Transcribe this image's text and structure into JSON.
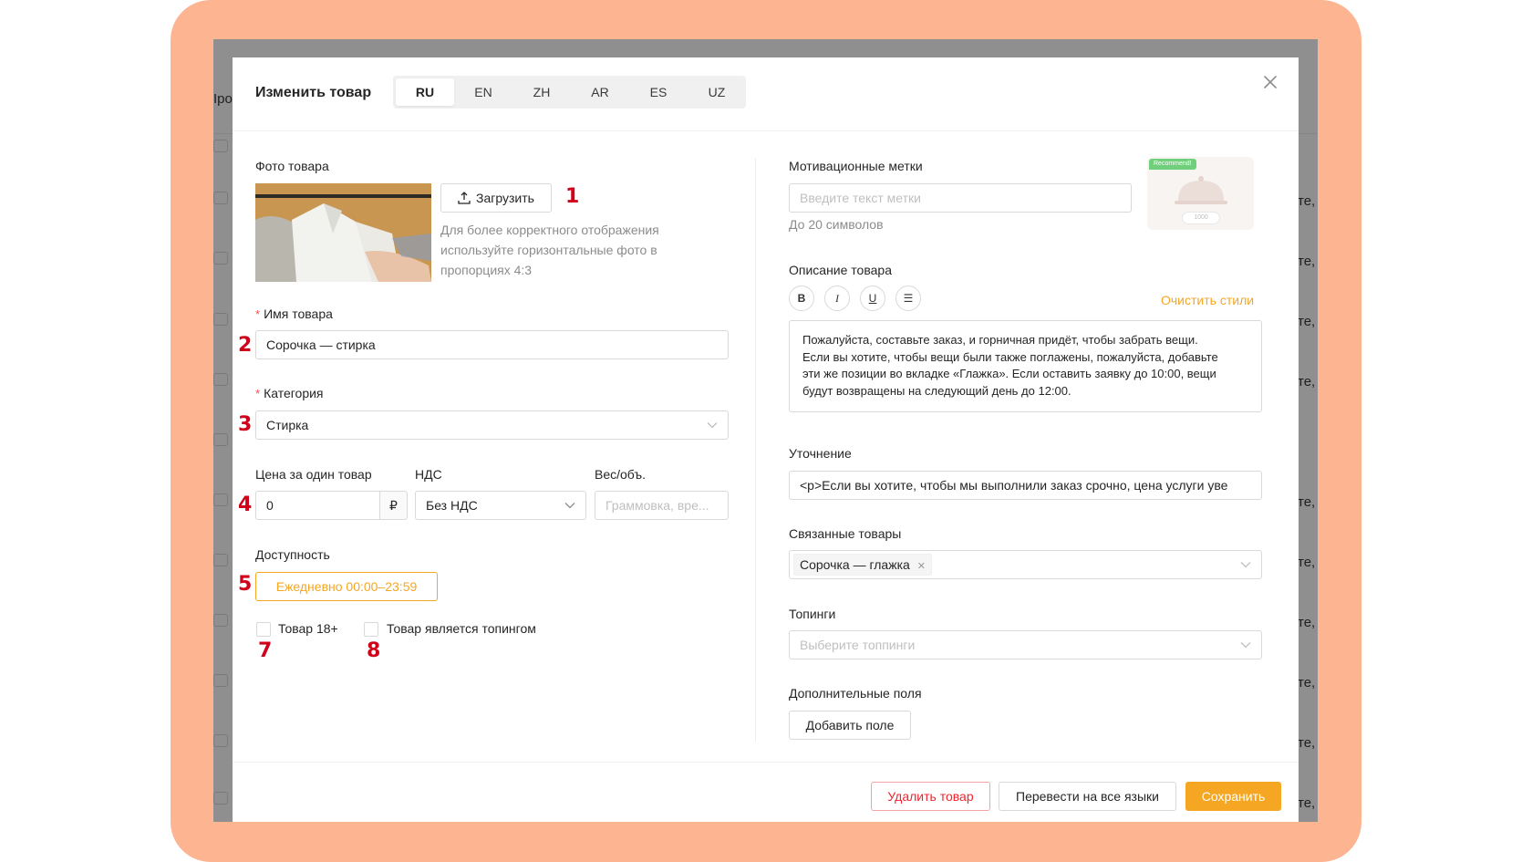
{
  "background": {
    "left_fragment": "Іро,",
    "right_fragments": [
      "те,",
      "те,",
      "те,",
      "те,",
      "те,",
      "те,",
      "те,",
      "те,",
      "те,",
      "те,"
    ]
  },
  "modal": {
    "title": "Изменить товар",
    "tabs": [
      {
        "label": "RU",
        "active": true
      },
      {
        "label": "EN",
        "active": false
      },
      {
        "label": "ZH",
        "active": false
      },
      {
        "label": "AR",
        "active": false
      },
      {
        "label": "ES",
        "active": false
      },
      {
        "label": "UZ",
        "active": false
      }
    ]
  },
  "left": {
    "photo_label": "Фото товара",
    "upload_button": "Загрузить",
    "photo_hint": [
      "Для более корректного отображения",
      "используйте горизонтальные фото в",
      "пропорциях 4:3"
    ],
    "name_label": "Имя товара",
    "name_value": "Сорочка — стирка",
    "category_label": "Категория",
    "category_value": "Стирка",
    "price_label": "Цена за один товар",
    "price_value": "0",
    "currency": "₽",
    "vat_label": "НДС",
    "vat_value": "Без НДС",
    "weight_label": "Вес/объ.",
    "weight_placeholder": "Граммовка, вре...",
    "availability_label": "Доступность",
    "availability_tag": "Ежедневно 00:00–23:59",
    "checkbox_adult": "Товар 18+",
    "checkbox_topping": "Товар является топингом"
  },
  "right": {
    "motivation_label": "Мотивационные метки",
    "motivation_placeholder": "Введите текст метки",
    "motivation_hint": "До 20 символов",
    "preview_badge": "Recommend!",
    "preview_price": "1000",
    "description_label": "Описание товара",
    "clear_styles": "Очистить стили",
    "format_buttons": [
      "B",
      "I",
      "U",
      "☰"
    ],
    "description_text": [
      "Пожалуйста, составьте заказ, и горничная придёт, чтобы забрать вещи.",
      "Если вы хотите, чтобы вещи были также поглажены, пожалуйста, добавьте",
      "эти же позиции во вкладке «Глажка». Если оставить заявку до 10:00, вещи",
      "будут возвращены на следующий день до 12:00."
    ],
    "clarification_label": "Уточнение",
    "clarification_value": "<p>Если вы хотите, чтобы мы выполнили заказ срочно, цена услуги уве",
    "related_label": "Связанные товары",
    "related_tag": "Сорочка — глажка",
    "toppings_label": "Топинги",
    "toppings_placeholder": "Выберите топпинги",
    "extra_fields_label": "Дополнительные поля",
    "add_field_button": "Добавить поле"
  },
  "footer": {
    "delete_button": "Удалить товар",
    "translate_button": "Перевести на все языки",
    "save_button": "Сохранить"
  },
  "annotations": [
    "1",
    "2",
    "3",
    "4",
    "5",
    "7",
    "8"
  ],
  "colors": {
    "frame": "#fdb491",
    "accent": "#f5a623",
    "danger": "#f5222d",
    "annotation": "#d0021b"
  }
}
